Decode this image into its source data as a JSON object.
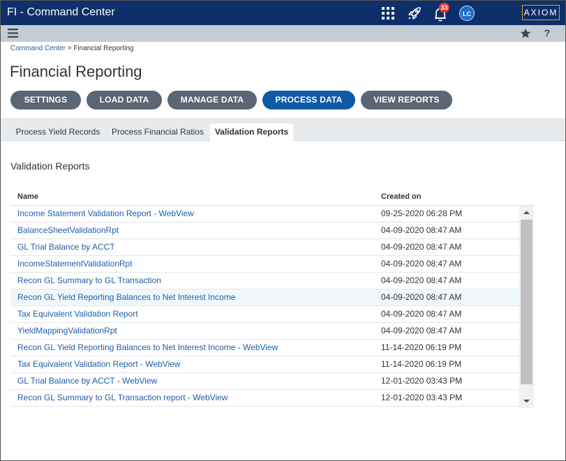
{
  "header": {
    "app_title": "FI - Command Center",
    "notification_count": "33",
    "avatar_initials": "LC",
    "logo_text": "AXIOM"
  },
  "breadcrumb": {
    "root": "Command Center",
    "separator": ">",
    "current": "Financial Reporting"
  },
  "page": {
    "title": "Financial Reporting"
  },
  "actions": [
    {
      "label": "SETTINGS"
    },
    {
      "label": "LOAD DATA"
    },
    {
      "label": "MANAGE DATA"
    },
    {
      "label": "PROCESS DATA",
      "active": true
    },
    {
      "label": "VIEW REPORTS"
    }
  ],
  "tabs": [
    {
      "label": "Process Yield Records"
    },
    {
      "label": "Process Financial Ratios"
    },
    {
      "label": "Validation Reports",
      "active": true
    }
  ],
  "section": {
    "title": "Validation Reports"
  },
  "table": {
    "columns": {
      "name": "Name",
      "created": "Created on"
    },
    "rows": [
      {
        "name": "Income Statement Validation Report - WebView",
        "created": "09-25-2020 06:28 PM"
      },
      {
        "name": "BalanceSheetValidationRpt",
        "created": "04-09-2020 08:47 AM"
      },
      {
        "name": "GL Trial Balance by ACCT",
        "created": "04-09-2020 08:47 AM"
      },
      {
        "name": "IncomeStatementValidationRpt",
        "created": "04-09-2020 08:47 AM"
      },
      {
        "name": "Recon GL Summary to GL Transaction",
        "created": "04-09-2020 08:47 AM"
      },
      {
        "name": "Recon GL Yield Reporting Balances to Net Interest Income",
        "created": "04-09-2020 08:47 AM"
      },
      {
        "name": "Tax Equivalent Validation Report",
        "created": "04-09-2020 08:47 AM"
      },
      {
        "name": "YieldMappingValidationRpt",
        "created": "04-09-2020 08:47 AM"
      },
      {
        "name": "Recon GL Yield Reporting Balances to Net Interest Income - WebView",
        "created": "11-14-2020 06:19 PM"
      },
      {
        "name": "Tax Equivalent Validation Report - WebView",
        "created": "11-14-2020 06:19 PM"
      },
      {
        "name": "GL Trial Balance by ACCT - WebView",
        "created": "12-01-2020 03:43 PM"
      },
      {
        "name": "Recon GL Summary to GL Transaction report - WebView",
        "created": "12-01-2020 03:43 PM"
      }
    ]
  },
  "colors": {
    "topbar": "#0d2f6a",
    "subbar": "#c4ccd4",
    "button": "#596673",
    "button_active": "#0e5aa7",
    "link": "#1d5ea8",
    "badge": "#e53935",
    "logo_border": "#e8a317"
  },
  "icons": {
    "apps": "grid-icon",
    "launch": "rocket-icon",
    "notifications": "bell-icon",
    "menu": "hamburger-menu-icon",
    "favorite": "star-icon",
    "help": "help-icon"
  }
}
